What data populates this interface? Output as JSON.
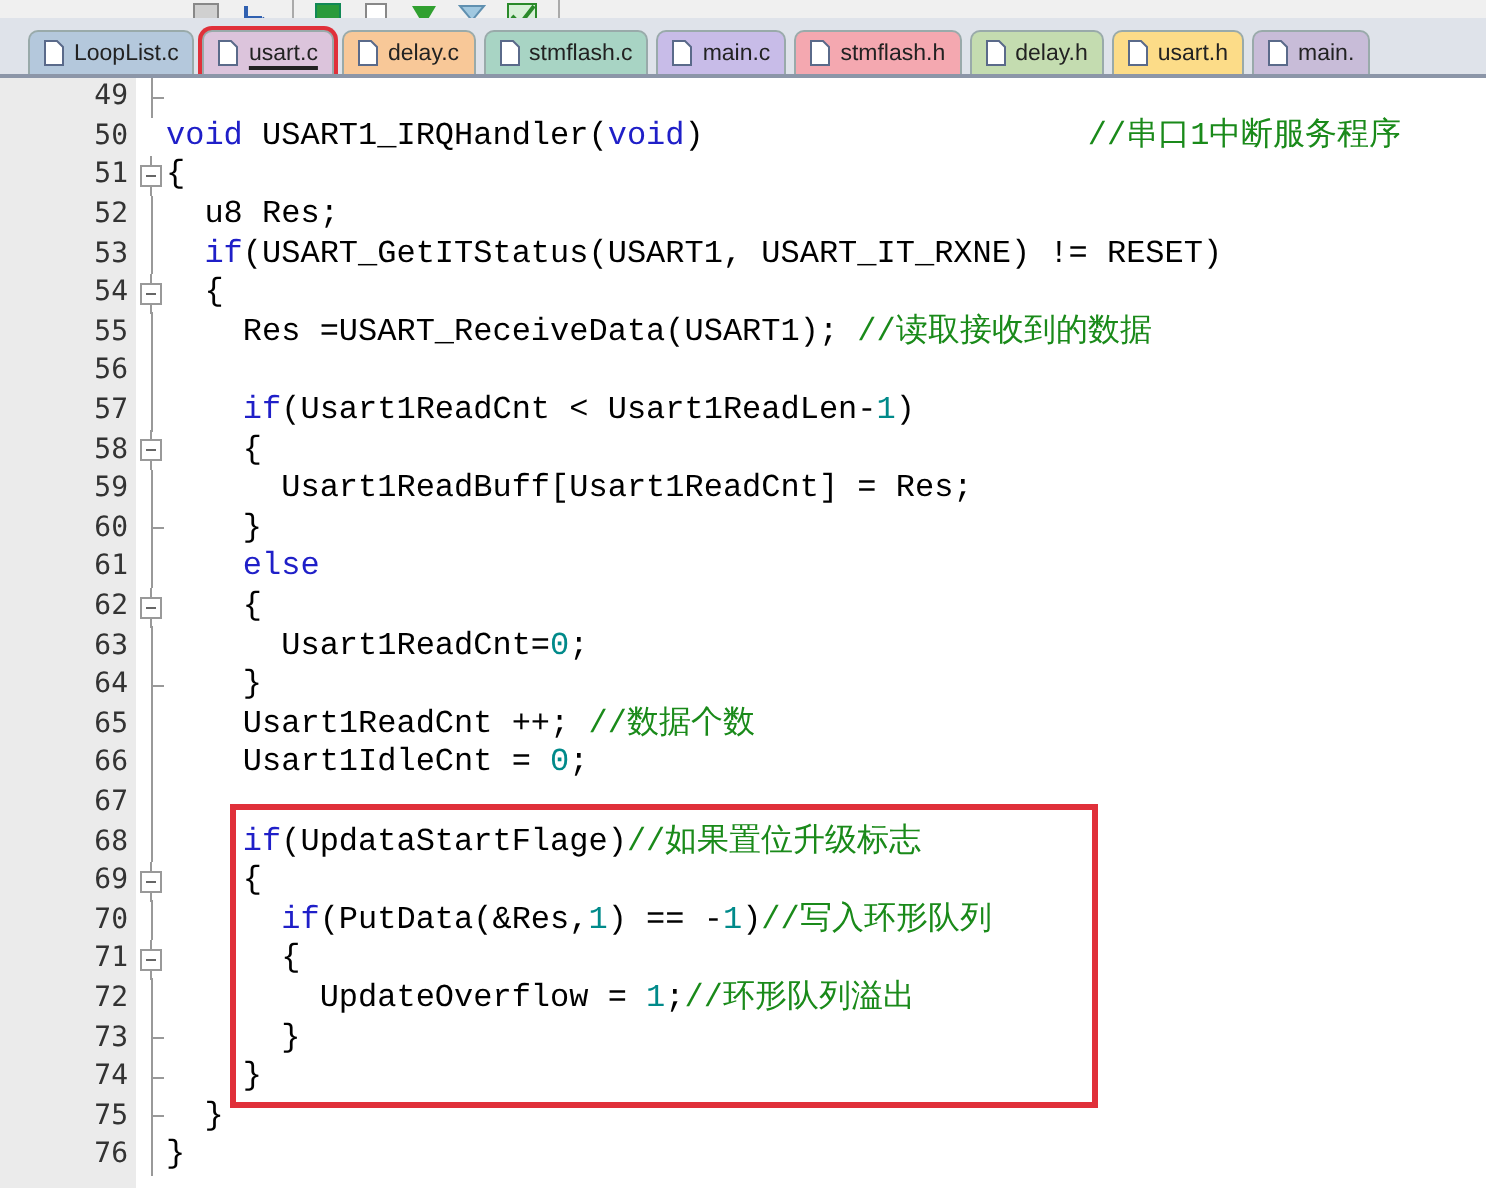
{
  "tabs": [
    {
      "label": "LoopList.c",
      "color": "#b4c8dc",
      "selected": false,
      "annotated": false
    },
    {
      "label": "usart.c",
      "color": "#dcc4dc",
      "selected": true,
      "annotated": true
    },
    {
      "label": "delay.c",
      "color": "#f8c898",
      "selected": false,
      "annotated": false
    },
    {
      "label": "stmflash.c",
      "color": "#a8d4c4",
      "selected": false,
      "annotated": false
    },
    {
      "label": "main.c",
      "color": "#c8bce8",
      "selected": false,
      "annotated": false
    },
    {
      "label": "stmflash.h",
      "color": "#f4a8b0",
      "selected": false,
      "annotated": false
    },
    {
      "label": "delay.h",
      "color": "#c4dcb0",
      "selected": false,
      "annotated": false
    },
    {
      "label": "usart.h",
      "color": "#fcdc88",
      "selected": false,
      "annotated": false
    },
    {
      "label": "main.",
      "color": "#c8bcd8",
      "selected": false,
      "annotated": false
    }
  ],
  "blocks": [
    {
      "boxed": false,
      "lines": [
        {
          "number": "49",
          "kind": "fold-end"
        },
        {
          "number": "50",
          "kind": "plain",
          "tokens": [
            {
              "kind": "keyword",
              "text": "void"
            },
            {
              "kind": "plain",
              "text": " USART1_IRQHandler("
            },
            {
              "kind": "keyword",
              "text": "void"
            },
            {
              "kind": "plain",
              "text": ")                    "
            },
            {
              "kind": "comment",
              "text": "//串口1中断服务程序"
            }
          ]
        },
        {
          "number": "51",
          "kind": "fold-start",
          "tokens": [
            {
              "kind": "plain",
              "text": "{"
            }
          ]
        },
        {
          "number": "52",
          "kind": "fold-line",
          "tokens": [
            {
              "kind": "plain",
              "text": "  u8 Res;"
            }
          ]
        },
        {
          "number": "53",
          "kind": "fold-line",
          "tokens": [
            {
              "kind": "keyword",
              "text": "  if"
            },
            {
              "kind": "plain",
              "text": "(USART_GetITStatus(USART1, USART_IT_RXNE) != RESET)"
            }
          ]
        },
        {
          "number": "54",
          "kind": "fold-start",
          "tokens": [
            {
              "kind": "plain",
              "text": "  {"
            }
          ]
        },
        {
          "number": "55",
          "kind": "fold-line",
          "tokens": [
            {
              "kind": "plain",
              "text": "    Res =USART_ReceiveData(USART1); "
            },
            {
              "kind": "comment",
              "text": "//读取接收到的数据"
            }
          ]
        },
        {
          "number": "56",
          "kind": "fold-line"
        },
        {
          "number": "57",
          "kind": "fold-line",
          "tokens": [
            {
              "kind": "keyword",
              "text": "    if"
            },
            {
              "kind": "plain",
              "text": "(Usart1ReadCnt < Usart1ReadLen-"
            },
            {
              "kind": "number",
              "text": "1"
            },
            {
              "kind": "plain",
              "text": ")"
            }
          ]
        },
        {
          "number": "58",
          "kind": "fold-start",
          "tokens": [
            {
              "kind": "plain",
              "text": "    {"
            }
          ]
        },
        {
          "number": "59",
          "kind": "fold-line",
          "tokens": [
            {
              "kind": "plain",
              "text": "      Usart1ReadBuff[Usart1ReadCnt] = Res;"
            }
          ]
        },
        {
          "number": "60",
          "kind": "fold-end",
          "tokens": [
            {
              "kind": "plain",
              "text": "    }"
            }
          ]
        },
        {
          "number": "61",
          "kind": "fold-line",
          "tokens": [
            {
              "kind": "keyword",
              "text": "    else"
            }
          ]
        },
        {
          "number": "62",
          "kind": "fold-start",
          "tokens": [
            {
              "kind": "plain",
              "text": "    {"
            }
          ]
        },
        {
          "number": "63",
          "kind": "fold-line",
          "tokens": [
            {
              "kind": "plain",
              "text": "      Usart1ReadCnt="
            },
            {
              "kind": "number",
              "text": "0"
            },
            {
              "kind": "plain",
              "text": ";"
            }
          ]
        },
        {
          "number": "64",
          "kind": "fold-end",
          "tokens": [
            {
              "kind": "plain",
              "text": "    }"
            }
          ]
        },
        {
          "number": "65",
          "kind": "fold-line",
          "tokens": [
            {
              "kind": "plain",
              "text": "    Usart1ReadCnt ++; "
            },
            {
              "kind": "comment",
              "text": "//数据个数"
            }
          ]
        },
        {
          "number": "66",
          "kind": "fold-line",
          "tokens": [
            {
              "kind": "plain",
              "text": "    Usart1IdleCnt = "
            },
            {
              "kind": "number",
              "text": "0"
            },
            {
              "kind": "plain",
              "text": ";"
            }
          ]
        },
        {
          "number": "67",
          "kind": "fold-line"
        }
      ]
    },
    {
      "boxed": true,
      "lines": [
        {
          "number": "68",
          "kind": "fold-line",
          "tokens": [
            {
              "kind": "keyword",
              "text": "    if"
            },
            {
              "kind": "plain",
              "text": "(UpdataStartFlage)"
            },
            {
              "kind": "comment",
              "text": "//如果置位升级标志"
            }
          ]
        },
        {
          "number": "69",
          "kind": "fold-start",
          "tokens": [
            {
              "kind": "plain",
              "text": "    {"
            }
          ]
        },
        {
          "number": "70",
          "kind": "fold-line",
          "tokens": [
            {
              "kind": "keyword",
              "text": "      if"
            },
            {
              "kind": "plain",
              "text": "(PutData(&Res,"
            },
            {
              "kind": "number",
              "text": "1"
            },
            {
              "kind": "plain",
              "text": ") == -"
            },
            {
              "kind": "number",
              "text": "1"
            },
            {
              "kind": "plain",
              "text": ")"
            },
            {
              "kind": "comment",
              "text": "//写入环形队列"
            }
          ]
        },
        {
          "number": "71",
          "kind": "fold-start",
          "tokens": [
            {
              "kind": "plain",
              "text": "      {"
            }
          ]
        },
        {
          "number": "72",
          "kind": "fold-line",
          "tokens": [
            {
              "kind": "plain",
              "text": "        UpdateOverflow = "
            },
            {
              "kind": "number",
              "text": "1"
            },
            {
              "kind": "plain",
              "text": ";"
            },
            {
              "kind": "comment",
              "text": "//环形队列溢出"
            }
          ]
        },
        {
          "number": "73",
          "kind": "fold-end",
          "tokens": [
            {
              "kind": "plain",
              "text": "      }"
            }
          ]
        },
        {
          "number": "74",
          "kind": "fold-end",
          "tokens": [
            {
              "kind": "plain",
              "text": "    }"
            }
          ]
        }
      ]
    },
    {
      "boxed": false,
      "lines": [
        {
          "number": "75",
          "kind": "fold-end",
          "tokens": [
            {
              "kind": "plain",
              "text": "  }"
            }
          ]
        },
        {
          "number": "76",
          "kind": "fold-line",
          "tokens": [
            {
              "kind": "plain",
              "text": "}"
            }
          ]
        }
      ]
    }
  ]
}
